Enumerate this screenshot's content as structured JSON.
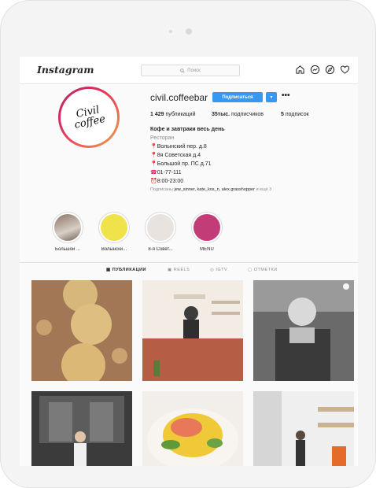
{
  "app": {
    "logo": "Instagram"
  },
  "search": {
    "placeholder": "Поиск",
    "icon": "search-icon"
  },
  "nav_icons": [
    "home-icon",
    "messenger-icon",
    "explore-icon",
    "heart-icon"
  ],
  "profile": {
    "username": "civil.coffeebar",
    "avatar_text": [
      "Civil",
      "coffee"
    ],
    "subscribe_label": "Подписаться",
    "dropdown_label": "▾",
    "more_label": "•••",
    "posts_count": "1 429",
    "posts_label": "публикаций",
    "followers_count": "35тыс.",
    "followers_label": "подписчиков",
    "following_count": "5",
    "following_label": "подписок",
    "bio_name": "Кофе и завтраки весь день",
    "bio_category": "Ресторан",
    "bio_lines": [
      "Волынский пер. д.8",
      "8я Советская д.4",
      "Большой пр. ПС д.71",
      "01-77-111",
      "8:00-23:00"
    ],
    "followed_by_prefix": "Подписаны",
    "followed_by_names": "jew_sinner, kate_kos_n, alex.grasshopper",
    "followed_by_suffix": "и ещё 3"
  },
  "highlights": [
    {
      "label": "Большой ...",
      "color": "#b09a8a"
    },
    {
      "label": "Волынски...",
      "color": "#f0e24a"
    },
    {
      "label": "8-я Совет...",
      "color": "#e8e3df"
    },
    {
      "label": "MENU",
      "color": "#c23c77"
    }
  ],
  "tabs": [
    {
      "label": "ПУБЛИКАЦИИ",
      "active": true
    },
    {
      "label": "REELS",
      "active": false
    },
    {
      "label": "IGTV",
      "active": false
    },
    {
      "label": "ОТМЕТКИ",
      "active": false
    }
  ],
  "colors": {
    "accent": "#3897f0",
    "text": "#262626",
    "muted": "#8e8e8e"
  }
}
